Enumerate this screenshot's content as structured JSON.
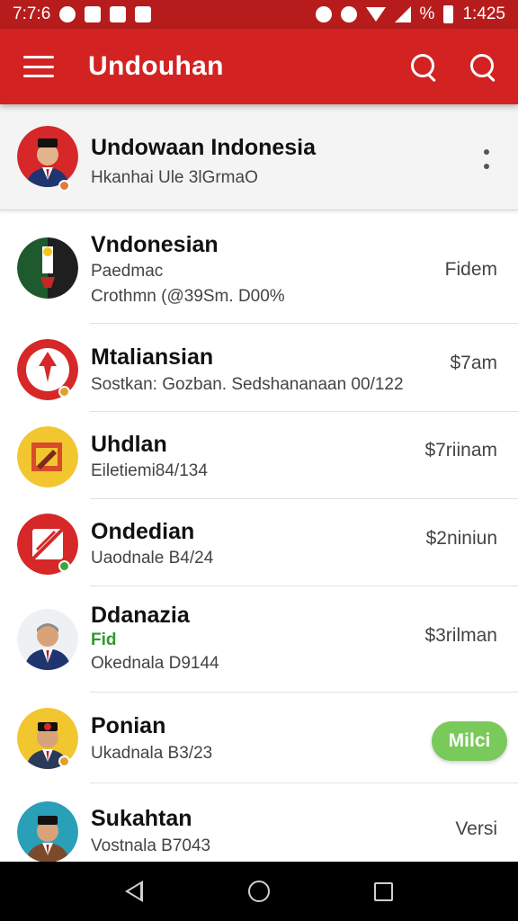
{
  "status_bar": {
    "time": "7:7:6",
    "battery_text": "%",
    "clock_right": "1:425"
  },
  "app_bar": {
    "title": "Undouhan"
  },
  "pinned": {
    "name": "Undowaan Indonesia",
    "subtitle": "Hkanhai Ule 3lGrmaO"
  },
  "rows": [
    {
      "name": "Vndonesian",
      "line1": "Paedmac",
      "line2": "Crothmn (@39Sm. D00%",
      "meta": "Fidem"
    },
    {
      "name": "Mtaliansian",
      "line1": "Sostkan: Gozban. Sedshananaan 00/122",
      "meta": "$7am"
    },
    {
      "name": "Uhdlan",
      "line1": "Eiletiemi84/134",
      "meta": "$7riinam"
    },
    {
      "name": "Ondedian",
      "line1": "Uaodnale B4/24",
      "meta": "$2niniun"
    },
    {
      "name": "Ddanazia",
      "line1": "Fid",
      "line2": "Okednala D9144",
      "meta": "$3rilman"
    },
    {
      "name": "Ponian",
      "line1": "Ukadnala B3/23",
      "pill": "Milci"
    },
    {
      "name": "Sukahtan",
      "line1": "Vostnala B7043",
      "meta": "Versi"
    }
  ],
  "colors": {
    "app_bar": "#d32222",
    "status_bar": "#b71c1c",
    "pill": "#7ac95b"
  },
  "icons": [
    "menu-icon",
    "search-icon",
    "search-icon",
    "more-vertical-icon",
    "nav-back-icon",
    "nav-home-icon",
    "nav-recents-icon"
  ]
}
